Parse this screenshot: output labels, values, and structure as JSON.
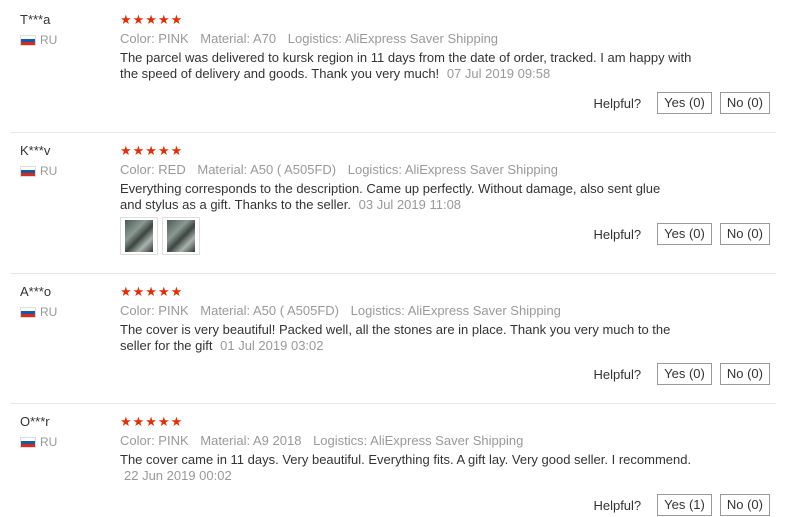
{
  "colors": {
    "star": "#e62e04",
    "muted": "#999999",
    "text": "#333333",
    "divider": "#e6e6e6"
  },
  "reviews": [
    {
      "user": "T***a",
      "country": "RU",
      "stars": "★★★★★",
      "color": "Color: PINK",
      "material": "Material: A70",
      "logistics": "Logistics: AliExpress Saver Shipping",
      "text": "The parcel was delivered to kursk region in 11 days from the date of order, tracked. I am happy with the speed of delivery and goods. Thank you very much!",
      "date": "07 Jul 2019 09:58",
      "helpful_label": "Helpful?",
      "yes": "Yes (0)",
      "no": "No (0)"
    },
    {
      "user": "K***v",
      "country": "RU",
      "stars": "★★★★★",
      "color": "Color: RED",
      "material": "Material: A50 ( A505FD)",
      "logistics": "Logistics: AliExpress Saver Shipping",
      "text": "Everything corresponds to the description. Came up perfectly. Without damage, also sent glue and stylus as a gift. Thanks to the seller.",
      "date": "03 Jul 2019 11:08",
      "helpful_label": "Helpful?",
      "yes": "Yes (0)",
      "no": "No (0)"
    },
    {
      "user": "A***o",
      "country": "RU",
      "stars": "★★★★★",
      "color": "Color: PINK",
      "material": "Material: A50 ( A505FD)",
      "logistics": "Logistics: AliExpress Saver Shipping",
      "text": "The cover is very beautiful! Packed well, all the stones are in place. Thank you very much to the seller for the gift",
      "date": "01 Jul 2019 03:02",
      "helpful_label": "Helpful?",
      "yes": "Yes (0)",
      "no": "No (0)"
    },
    {
      "user": "O***r",
      "country": "RU",
      "stars": "★★★★★",
      "color": "Color: PINK",
      "material": "Material: A9 2018",
      "logistics": "Logistics: AliExpress Saver Shipping",
      "text": "The cover came in 11 days. Very beautiful. Everything fits. A gift lay. Very good seller. I recommend.",
      "date": "22 Jun 2019 00:02",
      "helpful_label": "Helpful?",
      "yes": "Yes (1)",
      "no": "No (0)"
    }
  ]
}
